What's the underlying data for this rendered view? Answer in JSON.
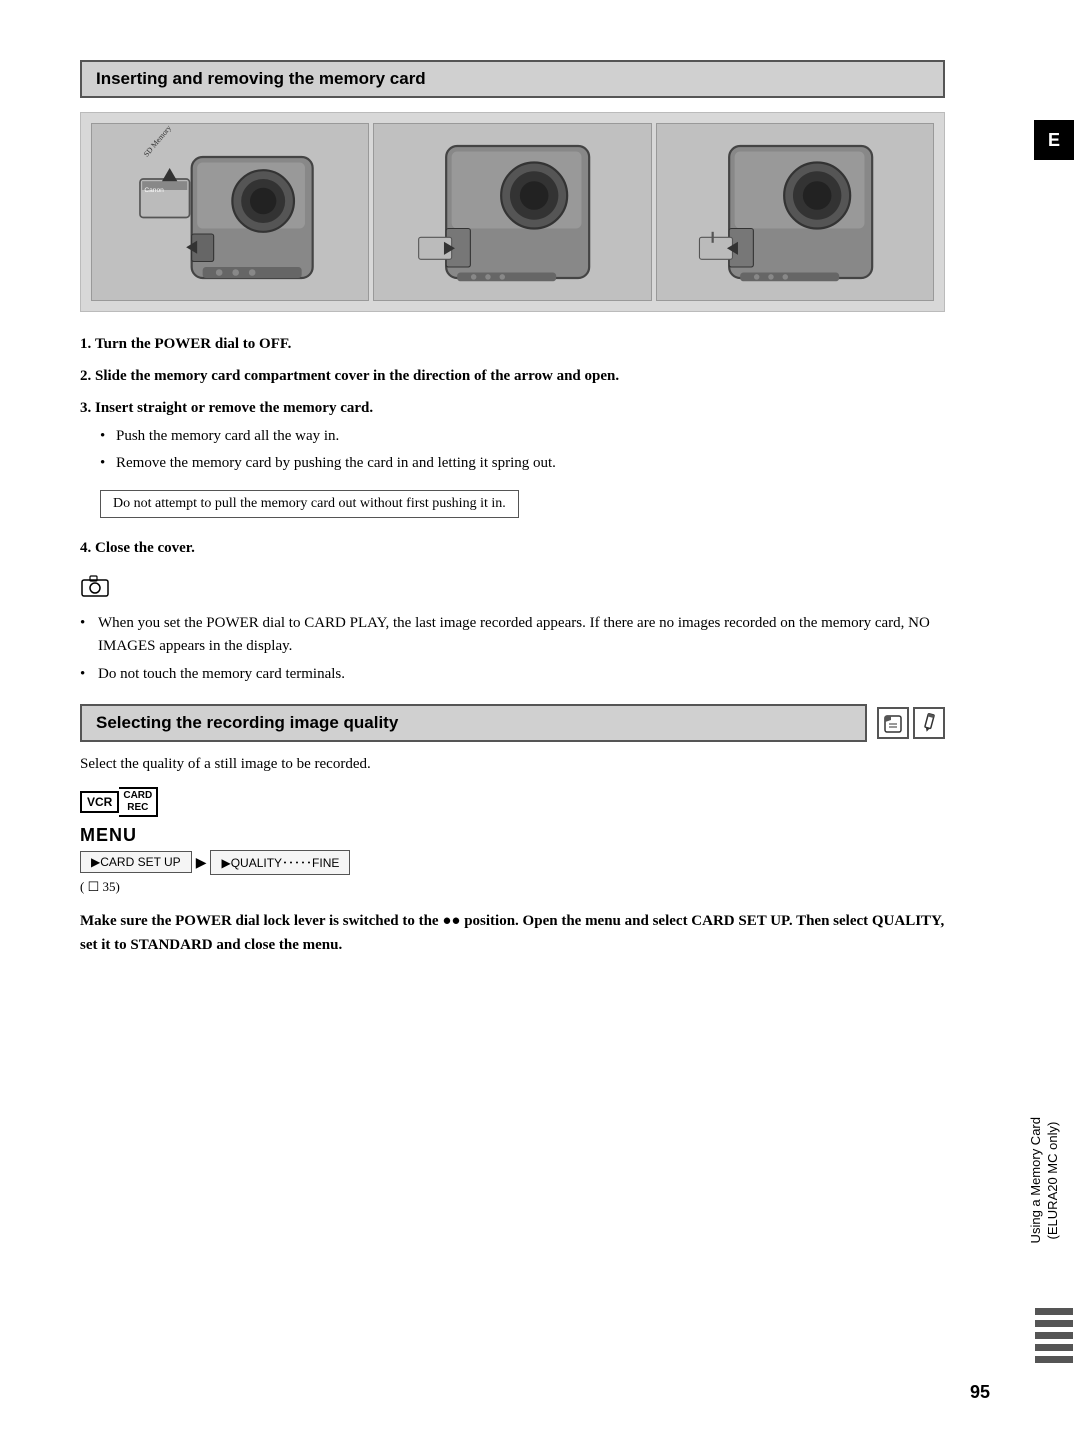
{
  "page": {
    "number": "95",
    "tab_letter": "E"
  },
  "sidebar": {
    "text_line1": "Using a Memory Card",
    "text_line2": "(ELURA20 MC only)"
  },
  "section1": {
    "title": "Inserting and removing the memory card",
    "steps": [
      {
        "number": "1.",
        "text": "Turn the POWER dial to OFF."
      },
      {
        "number": "2.",
        "text": "Slide the memory card compartment cover in the direction of the arrow and open."
      },
      {
        "number": "3.",
        "text": "Insert straight or remove the memory card.",
        "bullets": [
          "Push the memory card all the way in.",
          "Remove the memory card by pushing the card in and letting it spring out."
        ],
        "warning": "Do not attempt to pull the memory card out without first pushing it in."
      },
      {
        "number": "4.",
        "text": "Close the cover."
      }
    ],
    "notes": [
      "When you set the POWER dial to CARD PLAY, the last image recorded appears. If there are no images recorded on the memory card, NO IMAGES appears in the display.",
      "Do not touch the memory card terminals."
    ]
  },
  "section2": {
    "title": "Selecting the recording image quality",
    "select_text": "Select the quality of a still image to be recorded.",
    "vcr_label": "VCR",
    "card_rec_label_line1": "CARD",
    "card_rec_label_line2": "REC",
    "menu_label": "MENU",
    "menu_nav": [
      "▶CARD SET UP",
      "▶QUALITY･････FINE"
    ],
    "page_ref": "( ☐ 35)",
    "final_note": "Make sure the POWER dial lock lever is switched to the ●● position. Open the menu and select CARD SET UP. Then select QUALITY, set it to STANDARD and close the menu."
  }
}
